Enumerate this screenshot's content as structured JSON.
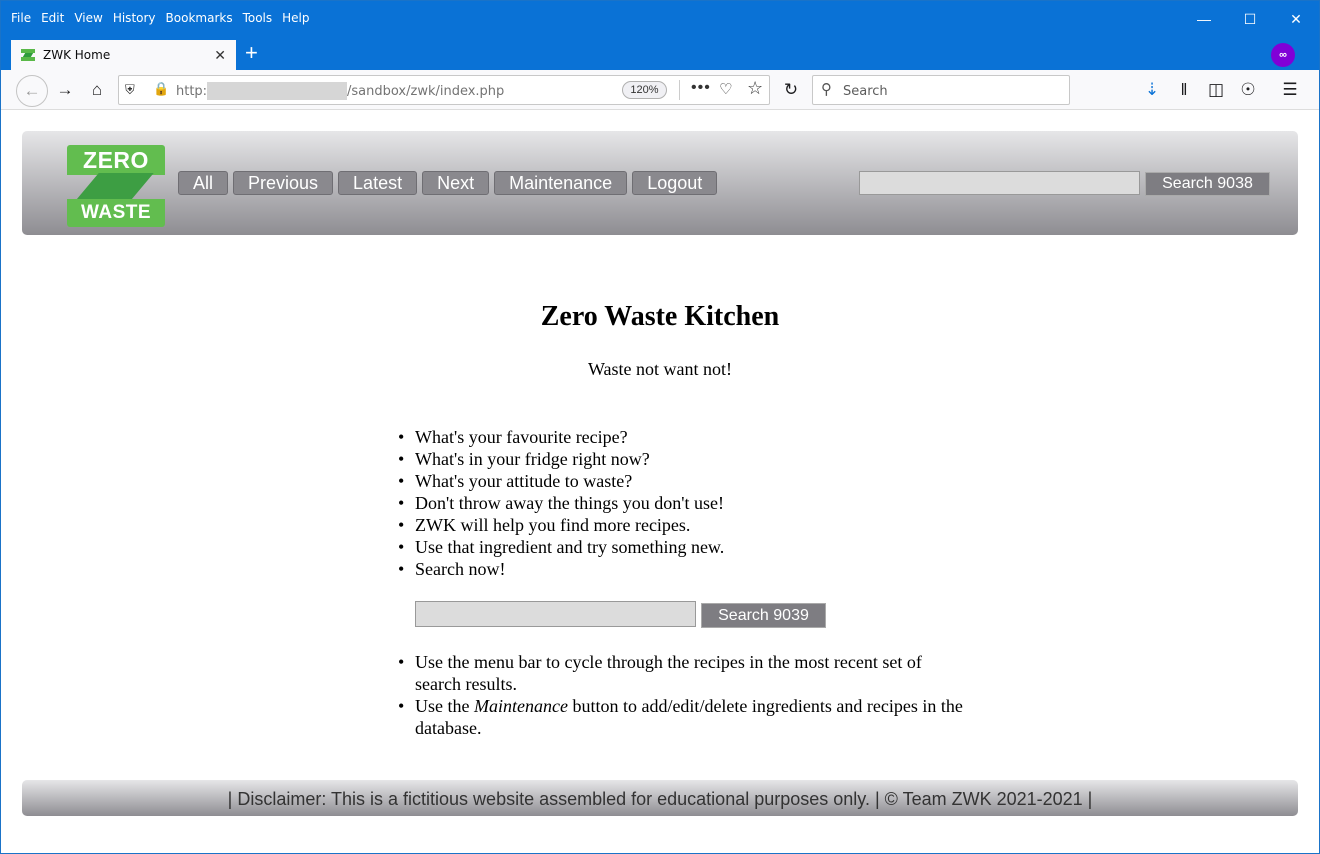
{
  "browser": {
    "menu": [
      "File",
      "Edit",
      "View",
      "History",
      "Bookmarks",
      "Tools",
      "Help"
    ],
    "tab_title": "ZWK Home",
    "url_scheme": "http:",
    "url_path": "/sandbox/zwk/index.php",
    "zoom": "120%",
    "search_placeholder": "Search",
    "window_controls": [
      "minimize",
      "maximize",
      "close"
    ]
  },
  "site": {
    "logo_top": "ZERO",
    "logo_bottom": "WASTE",
    "nav": [
      "All",
      "Previous",
      "Latest",
      "Next",
      "Maintenance",
      "Logout"
    ],
    "header_search_label": "Search 9038",
    "title": "Zero Waste Kitchen",
    "tagline": "Waste not want not!",
    "bullets": [
      "What's your favourite recipe?",
      "What's in your fridge right now?",
      "What's your attitude to waste?",
      "Don't throw away the things you don't use!",
      "ZWK will help you find more recipes.",
      "Use that ingredient and try something new.",
      "Search now!"
    ],
    "middle_search_label": "Search 9039",
    "help_bullets": [
      {
        "before": "Use the menu bar to cycle through the recipes in the most recent set of search results.",
        "em": "",
        "after": ""
      },
      {
        "before": "Use the ",
        "em": "Maintenance",
        "after": " button to add/edit/delete ingredients and recipes in the database."
      }
    ],
    "footer": "| Disclaimer: This is a fictitious website assembled for educational purposes only. | © Team ZWK 2021-2021 |"
  }
}
